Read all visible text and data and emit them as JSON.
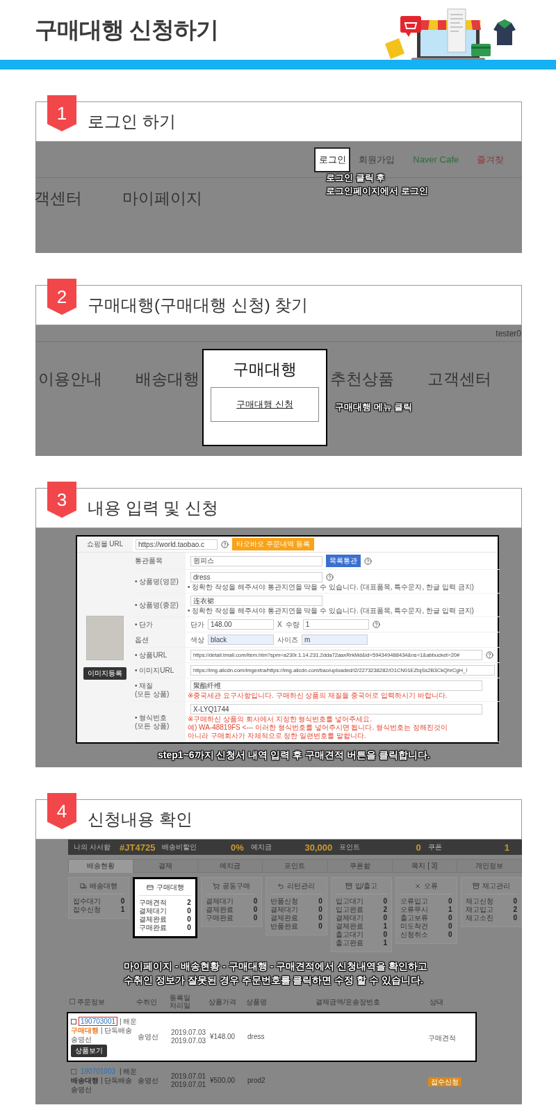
{
  "header": {
    "title": "구매대행 신청하기"
  },
  "steps": [
    {
      "number": "1",
      "title": "로그인 하기",
      "kind": "login",
      "top_links": [
        {
          "label": "로그인",
          "selected": true,
          "color": "#222222"
        },
        {
          "label": "회원가입",
          "selected": false,
          "color": "#3c3c3c"
        },
        {
          "label": "Naver Cafe",
          "selected": false,
          "color": "#2f6b3c"
        },
        {
          "label": "즐겨찾",
          "selected": false,
          "color": "#8e3b3b"
        }
      ],
      "nav": [
        "객센터",
        "마이페이지"
      ],
      "callout": [
        "로그인 클릭 후",
        "로그인페이지에서 로그인"
      ]
    },
    {
      "number": "2",
      "title": "구매대행(구매대행 신청) 찾기",
      "kind": "menu",
      "user": "tester0",
      "nav": [
        {
          "label": "이용안내",
          "selected": false
        },
        {
          "label": "배송대행",
          "selected": false
        },
        {
          "label": "구매대행",
          "selected": true
        },
        {
          "label": "추천상품",
          "selected": false
        },
        {
          "label": "고객센터",
          "selected": false
        }
      ],
      "submenu": "구매대행 신청",
      "callout": [
        "구매대행 메뉴 클릭"
      ]
    },
    {
      "number": "3",
      "title": "내용 입력 및 신청",
      "kind": "form",
      "shop_url": {
        "label": "쇼핑몰 URL",
        "value": "https://world.taobao.c",
        "button": "타오바오 주문내역 등록"
      },
      "image_button": "이미지등록",
      "rows": [
        {
          "kind": "input",
          "label": "통관품목",
          "value": "원피스",
          "button": "목록통관",
          "help": true
        },
        {
          "kind": "input",
          "label": "• 상품명(영문)",
          "value": "dress",
          "help": true,
          "notes": [
            "• 정확한 작성을 해주셔야 통관지연을 막을 수 있습니다. (대표품목, 특수문자, 한글 입력 금지)"
          ]
        },
        {
          "kind": "input",
          "label": "• 상품명(중문)",
          "value": "连衣裙",
          "help": false,
          "notes": [
            "• 정확한 작성을 해주셔야 통관지연을 막을 수 있습니다. (대표품목, 특수문자, 한글 입력 금지)"
          ]
        },
        {
          "kind": "pair",
          "label": "• 단가",
          "separator": "X",
          "help": true,
          "fields": [
            {
              "prefix": "단가",
              "value": "148.00",
              "autofilled": false
            },
            {
              "prefix": "수량",
              "value": "1",
              "autofilled": false
            }
          ]
        },
        {
          "kind": "pair",
          "label": "옵션",
          "help": false,
          "fields": [
            {
              "prefix": "색상",
              "value": "black",
              "autofilled": true
            },
            {
              "prefix": "사이즈",
              "value": "m",
              "autofilled": true
            }
          ]
        },
        {
          "kind": "url",
          "label": "• 상품URL",
          "value": "https://detail.tmall.com/item.htm?spm=a230r.1.14.231.2dda72aaxRrkMd&id=594349488434&ns=1&abbucket=20#",
          "help": true
        },
        {
          "kind": "url",
          "label": "• 이미지URL",
          "value": "https://img.alicdn.com/imgextra/https://img.alicdn.com/bao/uploaded/i2/2273238282/O1CN01EZtqSs2B3CkQhrCgH_!",
          "help": false
        },
        {
          "kind": "wide",
          "label": "• 재질",
          "sublabel": "(모든 상품)",
          "value": "聚酯纤维",
          "notes": [
            "※중국세관 요구사항입니다. 구매하신 상품의 재질을 중국어로 입력하시기 바랍니다."
          ]
        },
        {
          "kind": "wide",
          "label": "• 형식번호",
          "sublabel": "(모든 상품)",
          "value": "X-LYQ1744",
          "notes": [
            "※구매하신 상품의 회사에서 지정한 형식번호를 넣어주세요.",
            "예) WA-48819FS <--- 이러한 형식번호를 넣어주시면 됩니다. 형식번호는 정해진것이",
            "아니라 구매회사가 자체적으로 정한 일련번호를 말합니다."
          ]
        }
      ],
      "caption": [
        "step1~6까지 신청서 내역 입력 후 구매견적 버튼을 클릭합니다."
      ]
    },
    {
      "number": "4",
      "title": "신청내용 확인",
      "kind": "mypage",
      "summary": [
        {
          "label": "나의 사서함",
          "value": "#JT4725"
        },
        {
          "label": "배송비할인",
          "value": "0%"
        },
        {
          "label": "예치금",
          "value": "30,000"
        },
        {
          "label": "포인트",
          "value": "0"
        },
        {
          "label": "쿠폰",
          "value": "1"
        }
      ],
      "tabs": [
        {
          "label": "배송현황",
          "selected": true
        },
        {
          "label": "결제",
          "selected": false
        },
        {
          "label": "예치금",
          "selected": false
        },
        {
          "label": "포인트",
          "selected": false
        },
        {
          "label": "쿠폰함",
          "selected": false
        },
        {
          "label": "쪽지 [ 3]",
          "selected": false
        },
        {
          "label": "개인정보",
          "selected": false
        }
      ],
      "cards": [
        {
          "title": "배송대행",
          "selected": false,
          "rows": [
            [
              "접수대기",
              "0"
            ],
            [
              "접수신청",
              "1"
            ]
          ]
        },
        {
          "title": "구매대행",
          "selected": true,
          "rows": [
            [
              "구매견적",
              "2"
            ],
            [
              "결제대기",
              "0"
            ],
            [
              "결제완료",
              "0"
            ],
            [
              "구매완료",
              "0"
            ]
          ]
        },
        {
          "title": "공동구매",
          "selected": false,
          "rows": [
            [
              "결제대기",
              "0"
            ],
            [
              "결제완료",
              "0"
            ],
            [
              "구매완료",
              "0"
            ]
          ]
        },
        {
          "title": "리턴관리",
          "selected": false,
          "rows": [
            [
              "반품신청",
              "0"
            ],
            [
              "결제대기",
              "0"
            ],
            [
              "결제완료",
              "0"
            ],
            [
              "반품완료",
              "0"
            ]
          ]
        },
        {
          "title": "입/출고",
          "selected": false,
          "rows": [
            [
              "입고대기",
              "0"
            ],
            [
              "입고완료",
              "2"
            ],
            [
              "결제대기",
              "0"
            ],
            [
              "결제완료",
              "1"
            ],
            [
              "출고대기",
              "0"
            ],
            [
              "출고완료",
              "1"
            ]
          ]
        },
        {
          "title": "오류",
          "selected": false,
          "rows": [
            [
              "오류입고",
              "0"
            ],
            [
              "오류무시",
              "1"
            ],
            [
              "출고보류",
              "0"
            ],
            [
              "미도착건",
              "0"
            ],
            [
              "신청취소",
              "0"
            ]
          ]
        },
        {
          "title": "재고관리",
          "selected": false,
          "rows": [
            [
              "재고신청",
              "0"
            ],
            [
              "재고입고",
              "2"
            ],
            [
              "재고소진",
              "0"
            ]
          ]
        }
      ],
      "caption": [
        "마이페이지 - 배송현황 - 구매대행 - 구매견적에서 신청내역을 확인하고",
        "수취인 정보가 잘못된 경우 주문번호를 클릭하면 수정 할 수 있습니다."
      ],
      "table": {
        "select_all": {
          "checked": false
        },
        "columns": [
          "주문정보",
          "수취인",
          "등록일 처리일",
          "상품가격",
          "상품명",
          "결제금액/운송장번호",
          "상태"
        ],
        "rows": [
          {
            "selected": true,
            "checked": false,
            "order_no": "190703001",
            "order_marked": true,
            "ship": "| 해운",
            "service": {
              "label": "구매대행",
              "color": "#f07a22"
            },
            "delivery": "| 단독배송",
            "name": "송영선",
            "button": "상품보기",
            "recipient": "송영선",
            "dates": [
              "2019.07.03",
              "2019.07.03"
            ],
            "price": "¥148.00",
            "product": "dress",
            "status": {
              "label": "구매견적",
              "badge": false
            }
          },
          {
            "selected": false,
            "checked": false,
            "order_no": "190701003",
            "order_marked": false,
            "ship": "| 해운",
            "service": {
              "label": "배송대행",
              "color": "#333333"
            },
            "delivery": "| 단독배송",
            "name": "송영선",
            "recipient": "송영선",
            "dates": [
              "2019.07.01",
              "2019.07.01"
            ],
            "price": "¥500.00",
            "product": "prod2",
            "status": {
              "label": "접수신청",
              "badge": true
            }
          }
        ]
      }
    }
  ]
}
